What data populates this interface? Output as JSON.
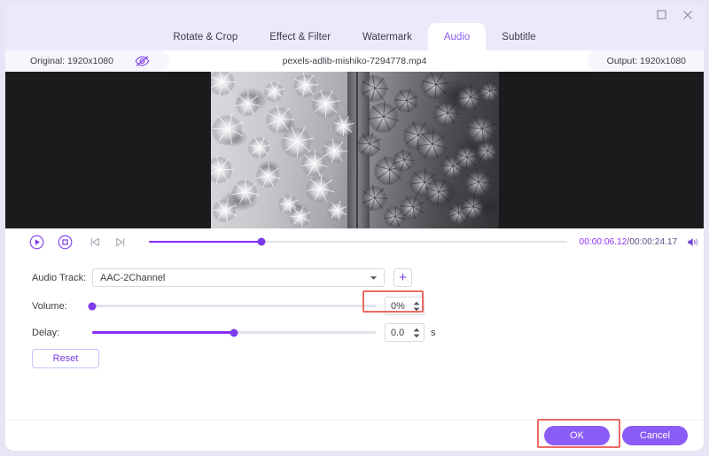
{
  "window": {
    "controls": [
      {
        "name": "maximize-button",
        "icon": "maximize-icon",
        "label": "Maximize"
      },
      {
        "name": "close-button",
        "icon": "close-icon",
        "label": "Close"
      }
    ]
  },
  "tabs": [
    {
      "label": "Rotate & Crop",
      "active": false
    },
    {
      "label": "Effect & Filter",
      "active": false
    },
    {
      "label": "Watermark",
      "active": false
    },
    {
      "label": "Audio",
      "active": true
    },
    {
      "label": "Subtitle",
      "active": false
    }
  ],
  "infobar": {
    "original_label": "Original: 1920x1080",
    "filename": "pexels-adlib-mishiko-7294778.mp4",
    "output_label": "Output: 1920x1080",
    "preview_toggle_icon": "eye-off-icon"
  },
  "player": {
    "play_icon": "play-circle-icon",
    "stop_icon": "stop-circle-icon",
    "prev_frame_icon": "previous-frame-icon",
    "next_frame_icon": "next-frame-icon",
    "volume_icon": "volume-icon",
    "current_time": "00:00:06.12",
    "separator": "/",
    "total_time": "00:00:24.17",
    "progress_percent": 27
  },
  "settings": {
    "audio_track": {
      "label": "Audio Track:",
      "value": "AAC-2Channel",
      "options": [
        "AAC-2Channel"
      ],
      "chevron_icon": "chevron-down-icon",
      "add_label": "+"
    },
    "volume": {
      "label": "Volume:",
      "value": "0%",
      "slider_percent": 0
    },
    "delay": {
      "label": "Delay:",
      "value": "0.0",
      "unit": "s",
      "slider_percent": 50
    },
    "reset_label": "Reset"
  },
  "footer": {
    "ok_label": "OK",
    "cancel_label": "Cancel"
  },
  "colors": {
    "accent": "#8b5cf6",
    "accent_strong": "#8b2bf5",
    "annotation": "#ec6a62",
    "tab_bg": "#eceafa",
    "page_bg": "#e7e5f6"
  }
}
